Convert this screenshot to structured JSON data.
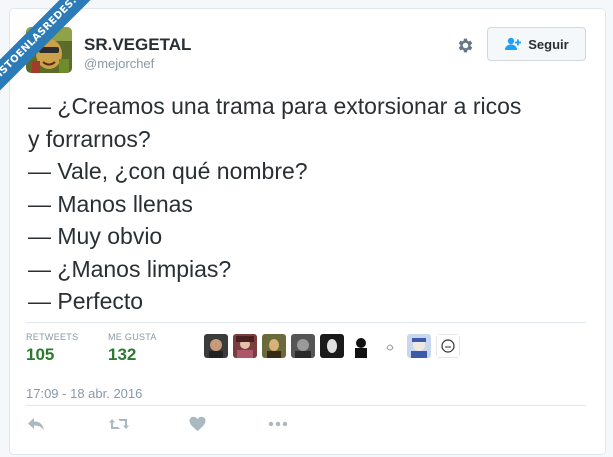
{
  "watermark": "VISTOENLASREDES.COM",
  "author": {
    "display_name": "SR.VEGETAL",
    "handle": "@mejorchef"
  },
  "follow_button": {
    "label": "Seguir"
  },
  "tweet": {
    "lines": [
      "— ¿Creamos una trama para extorsionar a ricos",
      "y forrarnos?",
      "— Vale, ¿con qué nombre?",
      "— Manos llenas",
      "— Muy obvio",
      "— ¿Manos limpias?",
      "— Perfecto"
    ]
  },
  "stats": {
    "retweets": {
      "label": "RETWEETS",
      "value": "105"
    },
    "likes": {
      "label": "ME GUSTA",
      "value": "132"
    }
  },
  "timestamp": "17:09 - 18 abr. 2016",
  "colors": {
    "stat_value": "#2a7b2f",
    "muted": "#8899a6",
    "text": "#292f33",
    "watermark": "#2b7bb9"
  },
  "actions": [
    "reply-icon",
    "retweet-icon",
    "like-icon",
    "more-icon"
  ]
}
